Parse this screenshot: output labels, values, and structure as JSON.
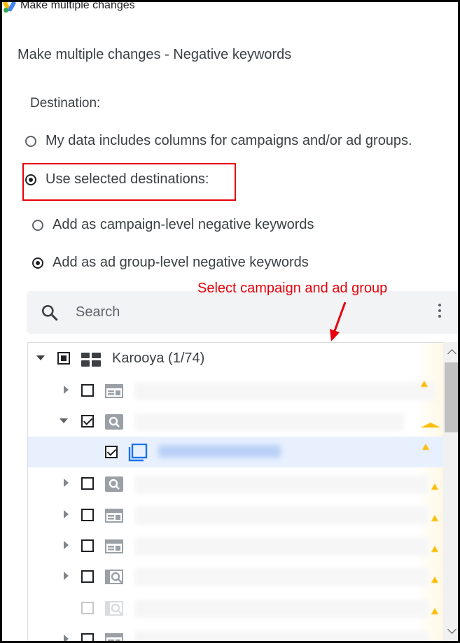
{
  "window": {
    "title": "Make multiple changes"
  },
  "dialog": {
    "heading": "Make multiple changes - Negative keywords",
    "destination_label": "Destination:",
    "destination_options": [
      {
        "label": "My data includes columns for campaigns and/or ad groups.",
        "checked": false
      },
      {
        "label": "Use selected destinations:",
        "checked": true
      }
    ],
    "level_options": [
      {
        "label": "Add as campaign-level negative keywords",
        "checked": false
      },
      {
        "label": "Add as ad group-level negative keywords",
        "checked": true
      }
    ]
  },
  "annotation": {
    "text": "Select campaign and ad group",
    "color": "#e8000a"
  },
  "search": {
    "placeholder": "Search",
    "icon": "search-icon",
    "menu_icon": "more-vert-icon"
  },
  "tree": {
    "root": {
      "label": "Karooya (1/74)",
      "expanded": true,
      "checkbox": "indeterminate",
      "icon": "account-icon"
    },
    "rows": [
      {
        "type": "campaign",
        "icon": "display-campaign-icon",
        "expanded": false,
        "checked": false
      },
      {
        "type": "campaign",
        "icon": "search-campaign-icon",
        "expanded": true,
        "checked": true
      },
      {
        "type": "ad-group",
        "icon": "ad-group-icon",
        "checked": true,
        "selected": true
      },
      {
        "type": "campaign",
        "icon": "search-campaign-icon",
        "expanded": false,
        "checked": false
      },
      {
        "type": "campaign",
        "icon": "display-campaign-icon",
        "expanded": false,
        "checked": false
      },
      {
        "type": "campaign",
        "icon": "display-campaign-icon",
        "expanded": false,
        "checked": false
      },
      {
        "type": "campaign",
        "icon": "search-network-campaign-icon",
        "expanded": false,
        "checked": false
      },
      {
        "type": "campaign",
        "icon": "search-network-campaign-icon",
        "expanded": false,
        "checked": false,
        "disabled": true
      },
      {
        "type": "campaign",
        "icon": "display-campaign-icon",
        "expanded": false,
        "checked": false
      }
    ]
  },
  "colors": {
    "accent_blue": "#1a73e8",
    "warning": "#fbbc04",
    "highlight": "#e8000a"
  }
}
